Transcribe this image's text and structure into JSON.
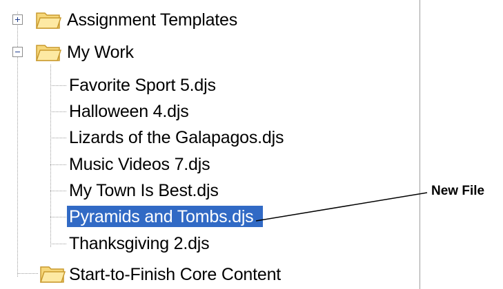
{
  "tree": {
    "assignment_templates": "Assignment Templates",
    "my_work": "My Work",
    "files": [
      "Favorite Sport 5.djs",
      "Halloween 4.djs",
      "Lizards of the Galapagos.djs",
      "Music Videos 7.djs",
      "My Town Is Best.djs",
      "Pyramids and Tombs.djs",
      "Thanksgiving 2.djs"
    ],
    "start_to_finish": "Start-to-Finish Core Content",
    "selected_index": 5
  },
  "callout": {
    "label": "New File"
  },
  "colors": {
    "selection": "#316ac5",
    "folder_fill": "#fde9a3",
    "folder_stroke": "#c99a2e"
  }
}
